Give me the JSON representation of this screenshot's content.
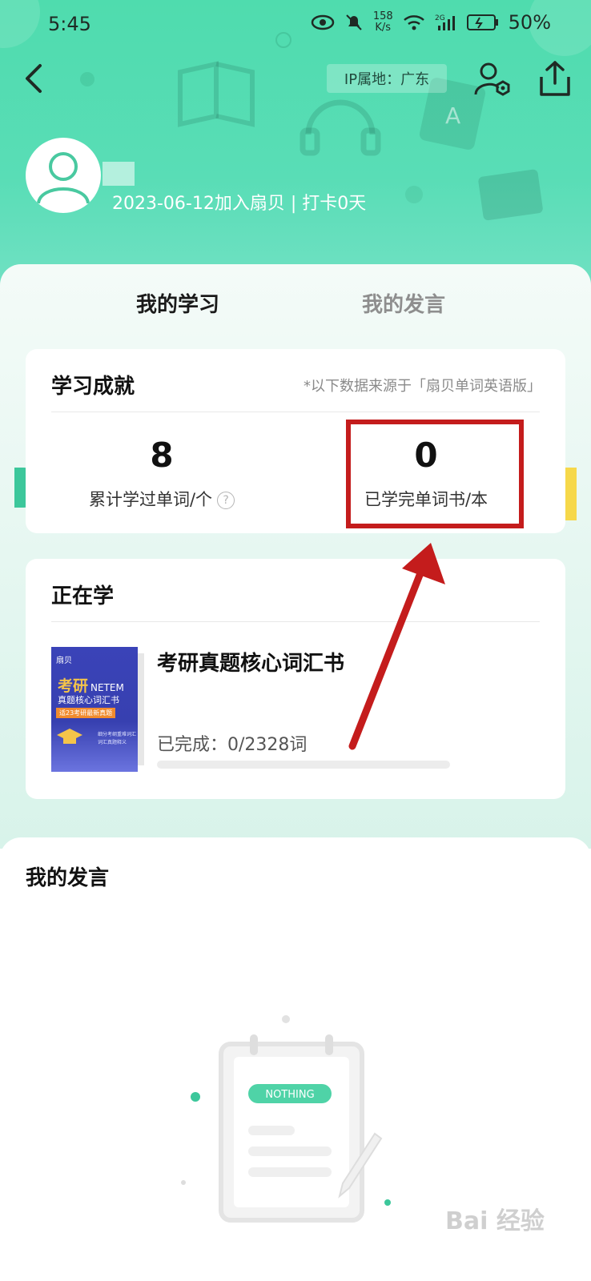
{
  "status_bar": {
    "time": "5:45",
    "net_speed_top": "158",
    "net_speed_bottom": "K/s",
    "signal_label": "2G",
    "battery": "50%"
  },
  "header": {
    "ip_location": "IP属地：广东",
    "join_info": "2023-06-12加入扇贝 | 打卡0天"
  },
  "tabs": {
    "active": "我的学习",
    "inactive": "我的发言"
  },
  "achievements": {
    "title": "学习成就",
    "note": "*以下数据来源于「扇贝单词英语版」",
    "words_learned": "8",
    "words_learned_label": "累计学过单词/个",
    "books_completed": "0",
    "books_completed_label": "已学完单词书/本"
  },
  "studying": {
    "title": "正在学",
    "book_title": "考研真题核心词汇书",
    "progress_label": "已完成：0/2328词",
    "progress_fraction": 0,
    "cover": {
      "brand": "扇贝",
      "main": "考研",
      "sub_en": "NETEM",
      "subtitle": "真题核心词汇书",
      "tag": "适23考研最新真题",
      "line1": "细分考纲重难词汇",
      "line2": "词汇真题释义"
    }
  },
  "posts": {
    "title": "我的发言",
    "empty_tag": "NOTHING"
  },
  "colors": {
    "brand_green": "#4fdcae",
    "highlight_red": "#c41c1c"
  }
}
